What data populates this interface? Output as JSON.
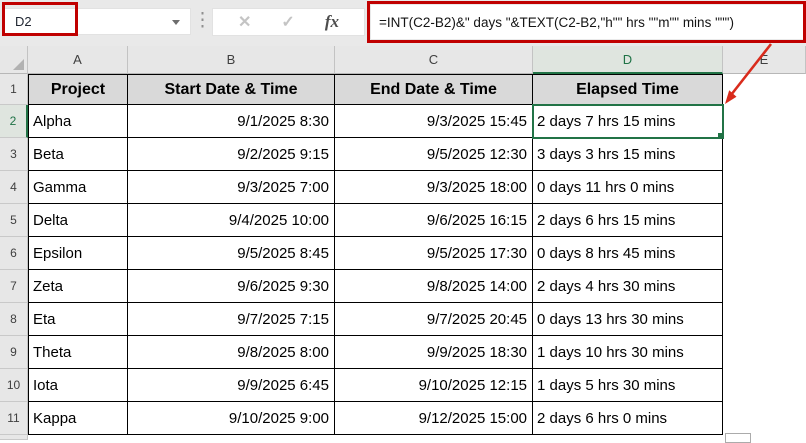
{
  "name_box": {
    "value": "D2"
  },
  "formula_bar": {
    "formula": "=INT(C2-B2)&\" days \"&TEXT(C2-B2,\"h\"\" hrs \"\"m\"\" mins \"\"\")"
  },
  "icons": {
    "dropdown": "name-box dropdown",
    "cancel": "✕",
    "enter": "✓",
    "fx": "fx",
    "dots": "⋮"
  },
  "colors": {
    "selection_green": "#217346",
    "annotation_red": "#C00000",
    "table_header_fill": "#D9D9D9"
  },
  "sheet": {
    "selected_cell": "D2",
    "column_headers": [
      "A",
      "B",
      "C",
      "D",
      "E"
    ],
    "header_row": {
      "num": "1",
      "project": "Project",
      "start": "Start Date & Time",
      "end": "End Date & Time",
      "elapsed": "Elapsed Time"
    },
    "rows": [
      {
        "num": "2",
        "project": "Alpha",
        "start": "9/1/2025 8:30",
        "end": "9/3/2025 15:45",
        "elapsed": "2 days 7 hrs 15 mins"
      },
      {
        "num": "3",
        "project": "Beta",
        "start": "9/2/2025 9:15",
        "end": "9/5/2025 12:30",
        "elapsed": "3 days 3 hrs 15 mins"
      },
      {
        "num": "4",
        "project": "Gamma",
        "start": "9/3/2025 7:00",
        "end": "9/3/2025 18:00",
        "elapsed": "0 days 11 hrs 0 mins"
      },
      {
        "num": "5",
        "project": "Delta",
        "start": "9/4/2025 10:00",
        "end": "9/6/2025 16:15",
        "elapsed": "2 days 6 hrs 15 mins"
      },
      {
        "num": "6",
        "project": "Epsilon",
        "start": "9/5/2025 8:45",
        "end": "9/5/2025 17:30",
        "elapsed": "0 days 8 hrs 45 mins"
      },
      {
        "num": "7",
        "project": "Zeta",
        "start": "9/6/2025 9:30",
        "end": "9/8/2025 14:00",
        "elapsed": "2 days 4 hrs 30 mins"
      },
      {
        "num": "8",
        "project": "Eta",
        "start": "9/7/2025 7:15",
        "end": "9/7/2025 20:45",
        "elapsed": "0 days 13 hrs 30 mins"
      },
      {
        "num": "9",
        "project": "Theta",
        "start": "9/8/2025 8:00",
        "end": "9/9/2025 18:30",
        "elapsed": "1 days 10 hrs 30 mins"
      },
      {
        "num": "10",
        "project": "Iota",
        "start": "9/9/2025 6:45",
        "end": "9/10/2025 12:15",
        "elapsed": "1 days 5 hrs 30 mins"
      },
      {
        "num": "11",
        "project": "Kappa",
        "start": "9/10/2025 9:00",
        "end": "9/12/2025 15:00",
        "elapsed": "2 days 6 hrs 0 mins"
      }
    ]
  }
}
